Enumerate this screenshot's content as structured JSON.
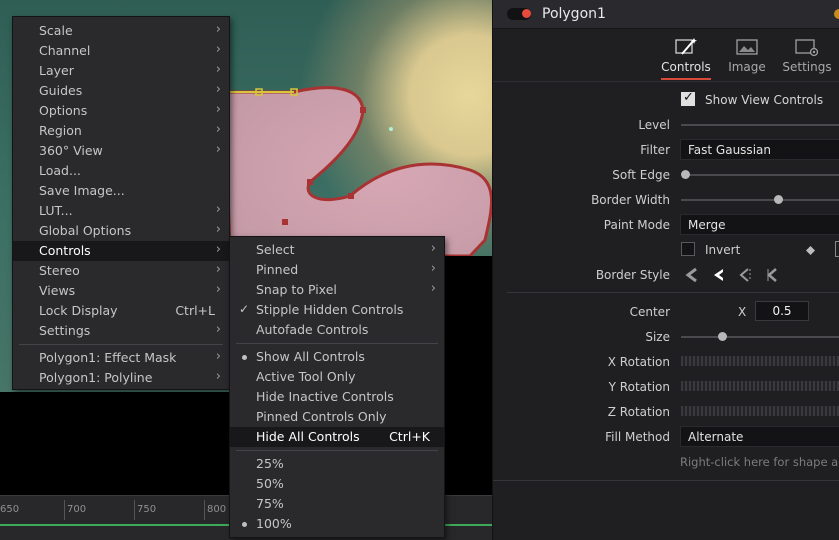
{
  "inspector": {
    "title": "Polygon1",
    "tabs": [
      {
        "label": "Controls",
        "icon": "controls-wand-icon",
        "active": true
      },
      {
        "label": "Image",
        "icon": "image-icon",
        "active": false
      },
      {
        "label": "Settings",
        "icon": "settings-gear-icon",
        "active": false
      }
    ],
    "show_view_controls": {
      "label": "Show View Controls",
      "checked": true
    },
    "level_label": "Level",
    "filter": {
      "label": "Filter",
      "value": "Fast Gaussian"
    },
    "soft_edge_label": "Soft Edge",
    "border_width_label": "Border Width",
    "paint_mode": {
      "label": "Paint Mode",
      "value": "Merge"
    },
    "invert": {
      "label": "Invert",
      "checked": false
    },
    "border_style_label": "Border Style",
    "center": {
      "label": "Center",
      "axis": "X",
      "value": "0.5"
    },
    "size_label": "Size",
    "x_rotation_label": "X Rotation",
    "y_rotation_label": "Y Rotation",
    "z_rotation_label": "Z Rotation",
    "fill_method": {
      "label": "Fill Method",
      "value": "Alternate"
    },
    "hint": "Right-click here for shape anima"
  },
  "timeline": {
    "ticks": [
      "650",
      "700",
      "750",
      "800"
    ]
  },
  "context_menu": {
    "items": [
      {
        "label": "Scale",
        "submenu": true
      },
      {
        "label": "Channel",
        "submenu": true
      },
      {
        "label": "Layer",
        "submenu": true
      },
      {
        "label": "Guides",
        "submenu": true
      },
      {
        "label": "Options",
        "submenu": true
      },
      {
        "label": "Region",
        "submenu": true
      },
      {
        "label": "360° View",
        "submenu": true
      },
      {
        "label": "Load...",
        "submenu": false
      },
      {
        "label": "Save Image...",
        "submenu": false
      },
      {
        "label": "LUT...",
        "submenu": true
      },
      {
        "label": "Global Options",
        "submenu": true
      },
      {
        "label": "Controls",
        "submenu": true,
        "highlighted": true
      },
      {
        "label": "Stereo",
        "submenu": true
      },
      {
        "label": "Views",
        "submenu": true
      },
      {
        "label": "Lock Display",
        "shortcut": "Ctrl+L",
        "submenu": false
      },
      {
        "label": "Settings",
        "submenu": true
      }
    ],
    "tool_items": [
      {
        "label": "Polygon1: Effect Mask",
        "submenu": true
      },
      {
        "label": "Polygon1: Polyline",
        "submenu": true
      }
    ]
  },
  "controls_submenu": {
    "group1": [
      {
        "label": "Select",
        "submenu": true
      },
      {
        "label": "Pinned",
        "submenu": true
      },
      {
        "label": "Snap to Pixel",
        "submenu": true
      },
      {
        "label": "Stipple Hidden Controls",
        "checked": true
      },
      {
        "label": "Autofade Controls"
      }
    ],
    "group2": [
      {
        "label": "Show All Controls",
        "selected": true
      },
      {
        "label": "Active Tool Only"
      },
      {
        "label": "Hide Inactive Controls"
      },
      {
        "label": "Pinned Controls Only"
      },
      {
        "label": "Hide All Controls",
        "shortcut": "Ctrl+K",
        "highlighted": true
      }
    ],
    "group3": [
      {
        "label": "25%"
      },
      {
        "label": "50%"
      },
      {
        "label": "75%"
      },
      {
        "label": "100%",
        "selected": true
      }
    ]
  }
}
